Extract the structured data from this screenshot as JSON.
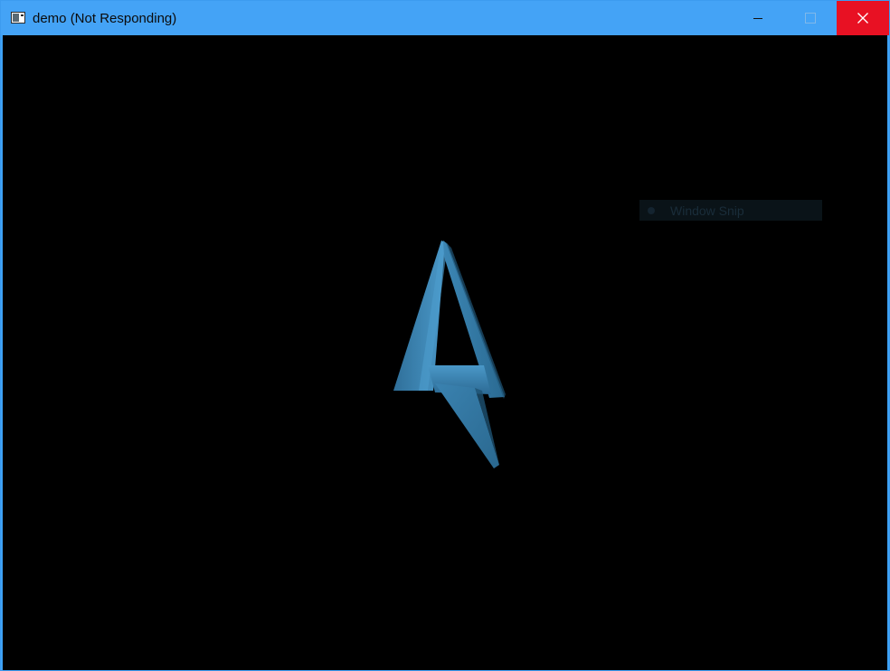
{
  "window": {
    "title": "demo (Not Responding)"
  },
  "titlebar_buttons": {
    "minimize_icon": "minimize-icon",
    "maximize_icon": "maximize-icon",
    "close_icon": "close-icon"
  },
  "overlay": {
    "label": "Window Snip"
  },
  "colors": {
    "titlebar": "#44a3f6",
    "close": "#e81123",
    "background": "#000000",
    "logo": "#3a7fa8"
  }
}
